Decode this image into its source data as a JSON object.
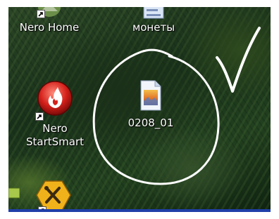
{
  "desktop": {
    "icons": [
      {
        "label": "Nero Home",
        "glyph": "nero-home-icon"
      },
      {
        "label": "монеты",
        "glyph": "document-icon"
      },
      {
        "label_line1": "Nero",
        "label_line2": "StartSmart",
        "glyph": "nero-startsmart-icon"
      },
      {
        "label": "0208_01",
        "glyph": "image-file-icon"
      },
      {
        "label": "",
        "glyph": "tools-icon"
      }
    ]
  },
  "colors": {
    "label": "#ffffff",
    "annotation": "#ffffff",
    "border": "#1f3fa8"
  }
}
